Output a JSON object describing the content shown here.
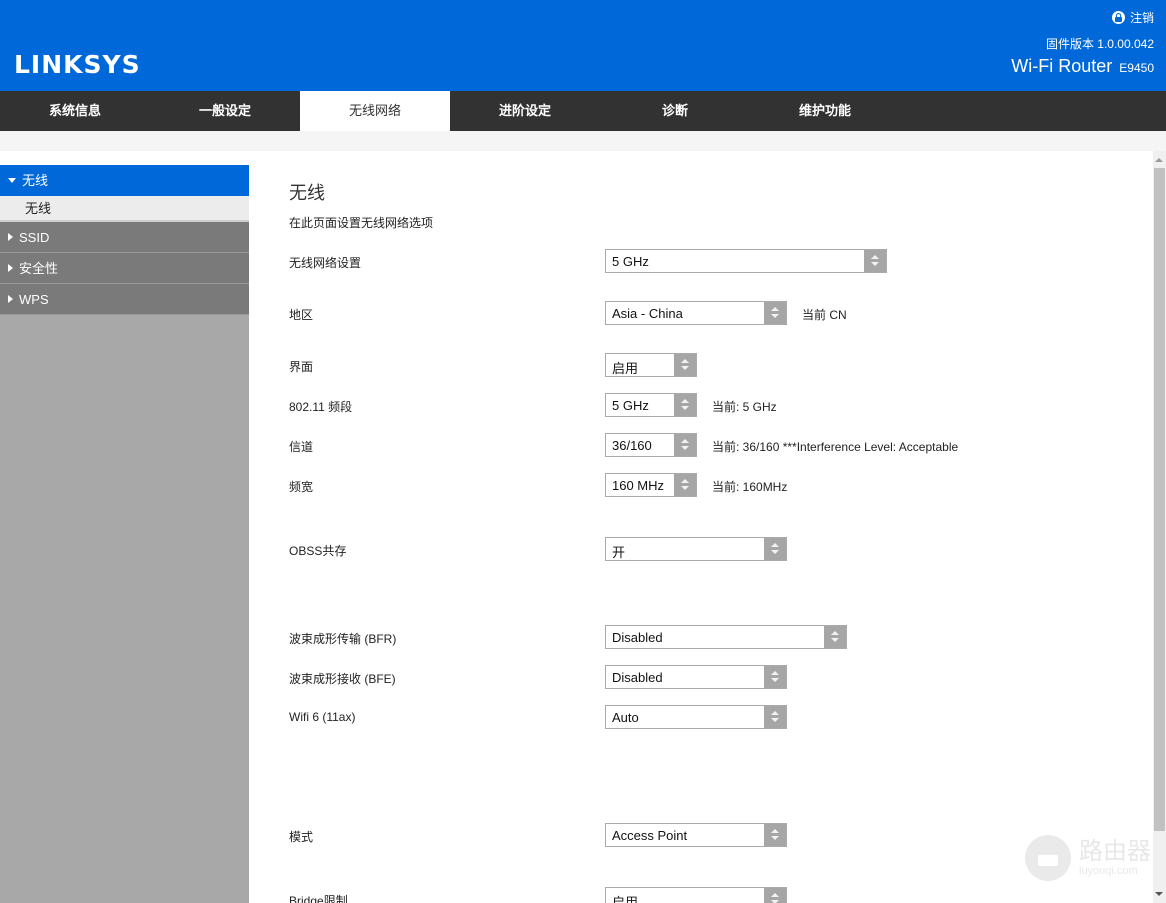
{
  "header": {
    "brand": "LINKSYS",
    "logout_label": "注销",
    "firmware_label": "固件版本 1.0.00.042",
    "product_name": "Wi-Fi Router",
    "model": "E9450",
    "brand_color": "#0068d9"
  },
  "nav": {
    "tabs": [
      {
        "label": "系统信息",
        "active": false
      },
      {
        "label": "一般设定",
        "active": false
      },
      {
        "label": "无线网络",
        "active": true
      },
      {
        "label": "进阶设定",
        "active": false
      },
      {
        "label": "诊断",
        "active": false
      },
      {
        "label": "维护功能",
        "active": false
      }
    ]
  },
  "sidebar": {
    "items": [
      {
        "label": "无线",
        "expanded": true,
        "active": true,
        "children": [
          {
            "label": "无线"
          }
        ]
      },
      {
        "label": "SSID",
        "expanded": false
      },
      {
        "label": "安全性",
        "expanded": false
      },
      {
        "label": "WPS",
        "expanded": false
      }
    ]
  },
  "main": {
    "title": "无线",
    "description": "在此页面设置无线网络选项",
    "fields": [
      {
        "label": "无线网络设置",
        "value": "5 GHz",
        "note": ""
      },
      {
        "label": "地区",
        "value": "Asia - China",
        "note": "当前 CN"
      },
      {
        "label": "界面",
        "value": "启用",
        "note": ""
      },
      {
        "label": "802.11 频段",
        "value": "5 GHz",
        "note": "当前: 5 GHz"
      },
      {
        "label": "信道",
        "value": "36/160",
        "note": "当前: 36/160 ***Interference Level: Acceptable"
      },
      {
        "label": "频宽",
        "value": "160 MHz",
        "note": "当前: 160MHz"
      },
      {
        "label": "OBSS共存",
        "value": "开",
        "note": ""
      },
      {
        "label": "波束成形传输 (BFR)",
        "value": "Disabled",
        "note": ""
      },
      {
        "label": "波束成形接收 (BFE)",
        "value": "Disabled",
        "note": ""
      },
      {
        "label": "Wifi 6 (11ax)",
        "value": "Auto",
        "note": ""
      },
      {
        "label": "模式",
        "value": "Access Point",
        "note": ""
      },
      {
        "label": "Bridge限制",
        "value": "启用",
        "note": ""
      }
    ]
  },
  "watermark": {
    "cn": "路由器",
    "en": "luyouqi.com"
  }
}
